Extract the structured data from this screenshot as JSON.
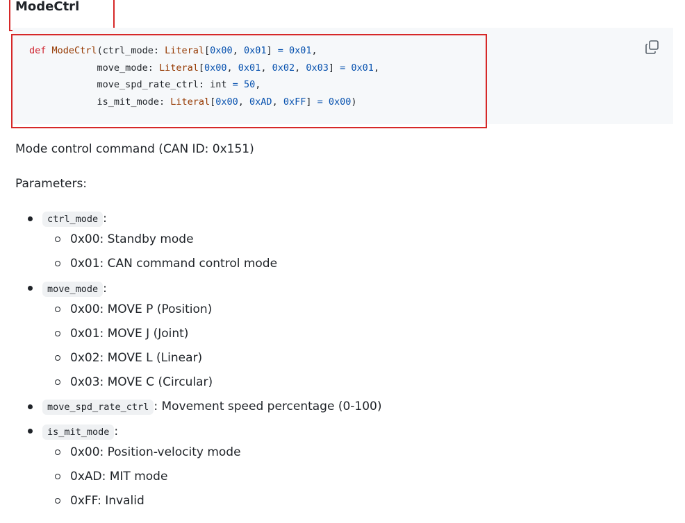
{
  "section": {
    "title": "ModeCtrl",
    "copy_icon": "copy-icon"
  },
  "code": {
    "kw_def": "def",
    "fn_name": "ModeCtrl",
    "lines": [
      {
        "param": "ctrl_mode",
        "type": "Literal",
        "values": [
          "0x00",
          "0x01"
        ],
        "default": "0x01",
        "end": ","
      },
      {
        "param": "move_mode",
        "type": "Literal",
        "values": [
          "0x00",
          "0x01",
          "0x02",
          "0x03"
        ],
        "default": "0x01",
        "end": ","
      },
      {
        "param": "move_spd_rate_ctrl",
        "type": "int",
        "default": "50",
        "end": ","
      },
      {
        "param": "is_mit_mode",
        "type": "Literal",
        "values": [
          "0x00",
          "0xAD",
          "0xFF"
        ],
        "default": "0x00",
        "end": ")"
      }
    ]
  },
  "description": "Mode control command (CAN ID: 0x151)",
  "params_label": "Parameters:",
  "params": [
    {
      "name": "ctrl_mode",
      "suffix": ":",
      "options": [
        "0x00: Standby mode",
        "0x01: CAN command control mode"
      ]
    },
    {
      "name": "move_mode",
      "suffix": ":",
      "options": [
        "0x00: MOVE P (Position)",
        "0x01: MOVE J (Joint)",
        "0x02: MOVE L (Linear)",
        "0x03: MOVE C (Circular)"
      ]
    },
    {
      "name": "move_spd_rate_ctrl",
      "suffix": ": Movement speed percentage (0-100)",
      "options": []
    },
    {
      "name": "is_mit_mode",
      "suffix": ":",
      "options": [
        "0x00: Position-velocity mode",
        "0xAD: MIT mode",
        "0xFF: Invalid"
      ]
    }
  ]
}
